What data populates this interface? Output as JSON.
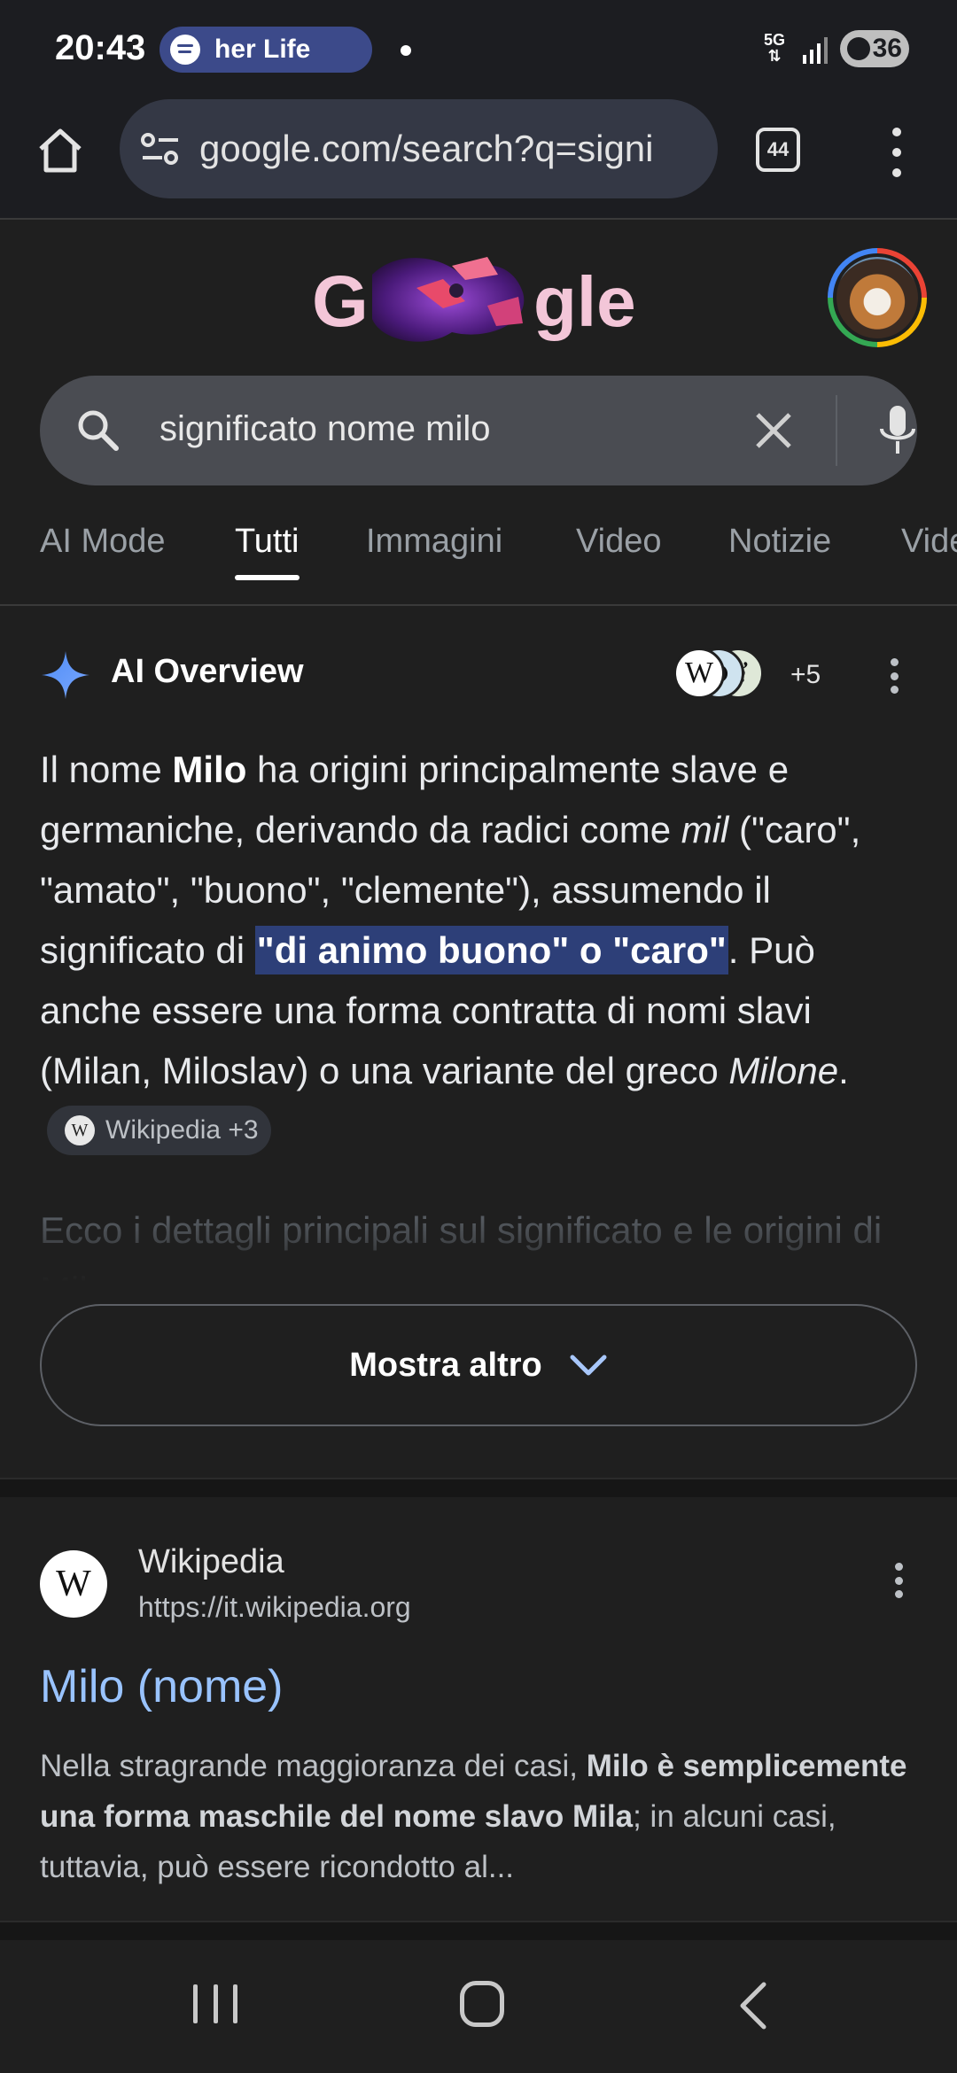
{
  "status_bar": {
    "time": "20:43",
    "media_text": "her Life",
    "network": "5G",
    "battery": "36"
  },
  "browser": {
    "url": "google.com/search?q=signi",
    "tab_count": "44"
  },
  "search": {
    "query": "significato nome milo"
  },
  "filter_tabs": [
    "AI Mode",
    "Tutti",
    "Immagini",
    "Video",
    "Notizie",
    "Vide"
  ],
  "active_tab": "Tutti",
  "ai_overview": {
    "title": "AI Overview",
    "sources_more": "+5",
    "text": {
      "p1": "Il nome ",
      "b1": "Milo",
      "p2": " ha origini principalmente slave e germaniche, derivando da radici come ",
      "i1": "mil",
      "p3": " (\"caro\", \"amato\", \"buono\", \"clemente\"), assumendo il significato di ",
      "hl": "\"di animo buono\" o \"caro\"",
      "p4": ". Può anche essere una forma contratta di nomi slavi (Milan, Miloslav) o una variante del greco ",
      "i2": "Milone",
      "p5": "."
    },
    "chip_label": "Wikipedia +3",
    "faded_text": "Ecco i dettagli principali sul significato e le origini di Milo:",
    "show_more": "Mostra altro"
  },
  "result": {
    "site": "Wikipedia",
    "url": "https://it.wikipedia.org",
    "title": "Milo (nome)",
    "snippet": {
      "s1": "Nella stragrande maggioranza dei casi, ",
      "b1": "Milo è semplicemente una forma maschile del nome slavo Mila",
      "s2": "; in alcuni casi, tuttavia, può essere ricondotto al..."
    }
  },
  "icons": {
    "spotify": "spotify-icon",
    "home": "home-icon",
    "tune": "site-settings-icon",
    "search": "search-icon",
    "clear": "close-icon",
    "mic": "mic-icon",
    "sparkle": "gemini-sparkle-icon",
    "chevron": "chevron-down-icon"
  },
  "colors": {
    "background": "#1f1f1f",
    "link": "#99c3ff",
    "highlight": "#2d3f78",
    "media_pill": "#3c4a8a"
  }
}
